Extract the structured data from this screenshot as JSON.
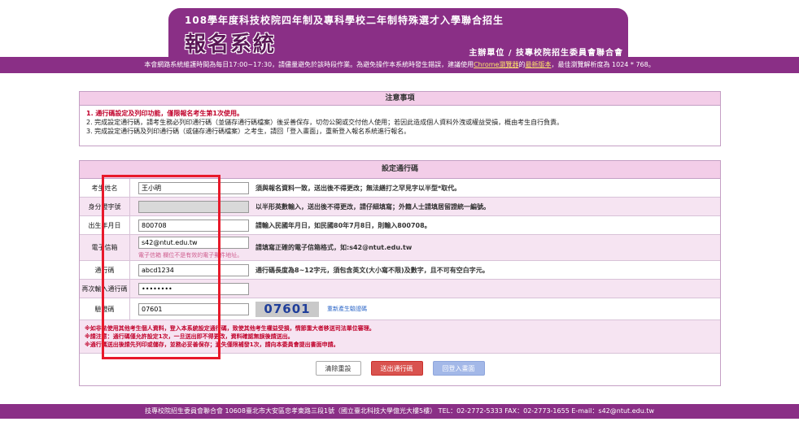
{
  "banner": {
    "title": "108學年度科技校院四年制及專科學校二年制特殊選才入學聯合招生",
    "logo": "報名系統",
    "subtitle": "主辦單位 / 技專校院招生委員會聯合會"
  },
  "notice": {
    "text_before": "本會網路系統維護時間為每日17:00~17:30，請儘量避免於該時段作業。為避免操作本系統時發生錯誤，建議使用",
    "link": "Chrome瀏覽器",
    "text_mid": "的",
    "link2": "最新版本",
    "text_after": "，最佳瀏覽解析度為 1024 * 768。"
  },
  "notes": {
    "heading": "注意事項",
    "line1": "1. 通行碼設定及列印功能，僅限報名考生第1次使用。",
    "line2": "2. 完成設定通行碼，請考生務必列印通行碼（並儲存通行碼檔案）後妥善保存，切勿公開或交付他人使用；若因此造成個人資料外洩或權益受損，概由考生自行負責。",
    "line3": "3. 完成設定通行碼及列印通行碼（或儲存通行碼檔案）之考生，請回「登入畫面」，重新登入報名系統進行報名。"
  },
  "form": {
    "heading": "設定通行碼",
    "rows": [
      {
        "label": "考生姓名",
        "value": "王小明",
        "desc": "須與報名資料一致，送出後不得更改；無法繕打之罕見字以半型*取代。"
      },
      {
        "label": "身分證字號",
        "value": "",
        "desc": "以半形英數輸入，送出後不得更改，請仔細填寫；外籍人士請填居留證統一編號。"
      },
      {
        "label": "出生年月日",
        "value": "800708",
        "desc": "請輸入民國年月日，如民國80年7月8日，則輸入800708。"
      },
      {
        "label": "電子信箱",
        "value": "s42@ntut.edu.tw",
        "desc": "請填寫正確的電子信箱格式，如:s42@ntut.edu.tw",
        "error": "電子信箱 欄位不是有效的電子郵件地址。"
      },
      {
        "label": "通行碼",
        "value": "abcd1234",
        "desc": "通行碼長度為8~12字元，須包含英文(大小寫不限)及數字，且不可有空白字元。"
      },
      {
        "label": "再次輸入通行碼",
        "value": "••••••••",
        "desc": ""
      },
      {
        "label": "驗證碼",
        "value": "07601",
        "captcha": "07601",
        "recaptcha": "重新產生驗證碼"
      }
    ],
    "warn1": "※如非法使用其他考生個人資料，登入本系統設定通行碼，致使其他考生權益受損，情節重大者移送司法單位審理。",
    "warn2": "※請注意：通行碼僅允許設定1次，一旦送出即不得更改，資料確認無誤後請送出。",
    "warn3": "※通行碼送出後請先列印或儲存，並務必妥善保存；遺失僅限補發1次，請向本委員會提出書面申請。",
    "btn_clear": "清除重設",
    "btn_submit": "送出通行碼",
    "btn_back": "回登入畫面"
  },
  "footer": {
    "text": "技專校院招生委員會聯合會 10608臺北市大安區忠孝東路三段1號（國立臺北科技大學億光大樓5樓） TEL：02-2772-5333 FAX：02-2773-1655 E-mail：s42@ntut.edu.tw"
  },
  "colors": {
    "brand": "#8a2f86",
    "header_pink": "#f3cde8",
    "highlight": "#e8192b"
  }
}
